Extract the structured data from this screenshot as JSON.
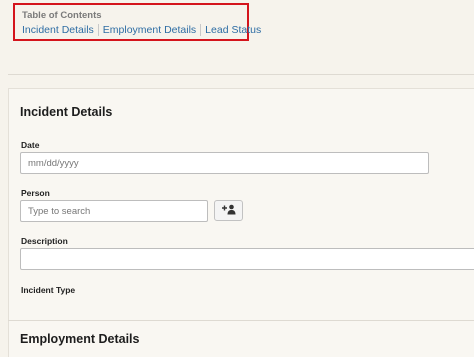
{
  "toc": {
    "title": "Table of Contents",
    "links": [
      "Incident Details",
      "Employment Details",
      "Lead Status"
    ]
  },
  "incident": {
    "title": "Incident Details",
    "date": {
      "label": "Date",
      "placeholder": "mm/dd/yyyy",
      "value": ""
    },
    "person": {
      "label": "Person",
      "placeholder": "Type to search",
      "value": "",
      "add_button_icon": "add-person-icon"
    },
    "description": {
      "label": "Description",
      "value": ""
    },
    "incident_type": {
      "label": "Incident Type"
    }
  },
  "employment": {
    "title": "Employment Details"
  },
  "colors": {
    "highlight_border": "#d4141c",
    "link": "#2e6da4",
    "background": "#f6f3ec"
  }
}
